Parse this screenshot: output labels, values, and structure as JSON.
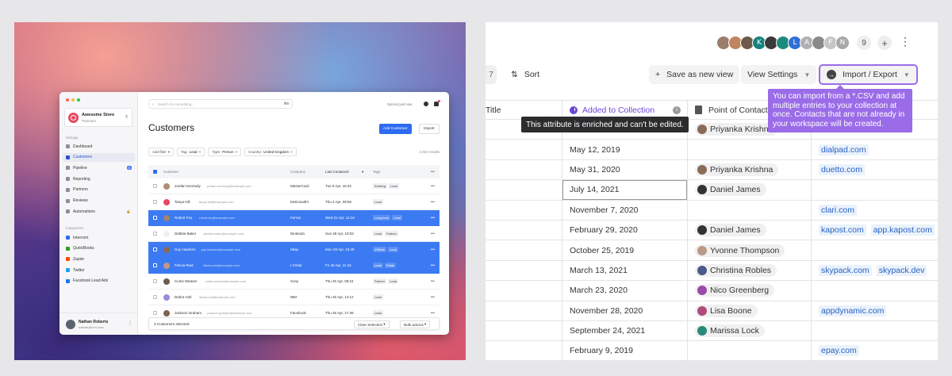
{
  "left": {
    "sidebar": {
      "store_name": "Awesome Store",
      "store_plan": "Premium",
      "manage_label": "Manage",
      "manage_items": [
        {
          "label": "Dashboard",
          "icon": "home-icon"
        },
        {
          "label": "Customers",
          "icon": "users-icon",
          "active": true
        },
        {
          "label": "Pipeline",
          "icon": "pipeline-icon",
          "badge": "6"
        },
        {
          "label": "Reporting",
          "icon": "chart-icon"
        },
        {
          "label": "Partners",
          "icon": "partners-icon"
        },
        {
          "label": "Reviews",
          "icon": "reviews-icon"
        },
        {
          "label": "Automations",
          "icon": "automations-icon",
          "locked": true
        }
      ],
      "integrations_label": "Integrations",
      "integration_items": [
        {
          "label": "Intercom",
          "color": "#2d6bf0"
        },
        {
          "label": "QuickBooks",
          "color": "#2ca01c"
        },
        {
          "label": "Zapier",
          "color": "#ff4a00"
        },
        {
          "label": "Twitter",
          "color": "#1da1f2"
        },
        {
          "label": "Facebook Lead Ads",
          "color": "#1877f2"
        }
      ],
      "user_name": "Nathan Roberts",
      "user_email": "nathan@crm.com"
    },
    "header": {
      "search_placeholder": "Search for something...",
      "search_shortcut": "⌘K",
      "synced": "Synced just now",
      "title": "Customers",
      "add_button": "Add Customer",
      "import_button": "Import"
    },
    "filters": {
      "add_filter": "Add filter",
      "chips": [
        {
          "key": "Tag:",
          "value": "Lead"
        },
        {
          "key": "Type:",
          "value": "Person"
        },
        {
          "key": "Country:",
          "value": "United Kingdom"
        }
      ],
      "results": "1,024 results"
    },
    "table": {
      "headers": {
        "customer": "Customer",
        "company": "Company",
        "last_contacted": "Last Contacted",
        "tags": "Tags"
      },
      "rows": [
        {
          "name": "Jordan Kennedy",
          "email": "jordan.kennedy@example.com",
          "company": "MasterCard",
          "date": "Tue 6 Apr, 16:42",
          "tags": [
            "Existing",
            "Lead"
          ],
          "selected": false,
          "avatar_color": "#b08c74"
        },
        {
          "name": "Tanya Hill",
          "email": "tanya.hill@example.com",
          "company": "McDonald's",
          "date": "Thu 2 Apr, 09:56",
          "tags": [
            "Lead"
          ],
          "selected": false,
          "avatar_color": "#e8485f"
        },
        {
          "name": "Robert Fox",
          "email": "robert.fox@example.com",
          "company": "Ferrari",
          "date": "Wed 31 Apr, 12:34",
          "tags": [
            "Long-term",
            "Lead"
          ],
          "selected": true,
          "avatar_color": "#a0826d"
        },
        {
          "name": "Debbie Baker",
          "email": "debbie.baker@example.com",
          "company": "Nintendo",
          "date": "Sun 28 Apr, 19:03",
          "tags": [
            "Lead",
            "Partner"
          ],
          "selected": false,
          "avatar_color": "#f0f0f0"
        },
        {
          "name": "Guy Hawkins",
          "email": "guy.hawkins@example.com",
          "company": "eBay",
          "date": "Mon 29 Apr, 15:49",
          "tags": [
            "Affiliate",
            "Lead"
          ],
          "selected": true,
          "avatar_color": "#8a6a55"
        },
        {
          "name": "Felicia Reid",
          "email": "felicia.reid@example.com",
          "company": "L'Oréal",
          "date": "Fri 26 Apr, 11:43",
          "tags": [
            "Lead",
            "Retail"
          ],
          "selected": true,
          "avatar_color": "#c49a82"
        },
        {
          "name": "Curtis Weaver",
          "email": "curtis.weaver@example.com",
          "company": "Sony",
          "date": "Thu 25 Apr, 08:24",
          "tags": [
            "Partner",
            "Lead"
          ],
          "selected": false,
          "avatar_color": "#6d5a4e"
        },
        {
          "name": "Debra Holt",
          "email": "debra.holt@example.com",
          "company": "IBM",
          "date": "Thu 25 Apr, 14:12",
          "tags": [
            "Lead"
          ],
          "selected": false,
          "avatar_color": "#9b8bd8"
        },
        {
          "name": "Jackson Graham",
          "email": "jackson.graham@example.com",
          "company": "Facebook",
          "date": "Thu 25 Apr, 17:39",
          "tags": [
            "Lead"
          ],
          "selected": false,
          "avatar_color": "#7d6250"
        }
      ]
    },
    "bulk": {
      "count": "3 Customers selected",
      "clear": "Clear Selection",
      "actions": "Bulk actions"
    }
  },
  "right": {
    "avatars": [
      {
        "color": "#9b7d6a",
        "letter": ""
      },
      {
        "color": "#c08560",
        "letter": ""
      },
      {
        "color": "#6e5a4c",
        "letter": ""
      },
      {
        "color": "#16817e",
        "letter": "K"
      },
      {
        "color": "#3b3b3b",
        "letter": ""
      },
      {
        "color": "#1e8a7e",
        "letter": ""
      },
      {
        "color": "#2e6fd6",
        "letter": "L"
      },
      {
        "color": "#b0b0b0",
        "letter": "A"
      },
      {
        "color": "#8a8a8a",
        "letter": ""
      },
      {
        "color": "#c5c5c5",
        "letter": "F"
      },
      {
        "color": "#a8a8a8",
        "letter": "N"
      }
    ],
    "member_count": "9",
    "toolbar": {
      "prev_label": "7",
      "sort": "Sort",
      "save_view": "Save as new view",
      "view_settings": "View Settings",
      "import_export": "Import / Export"
    },
    "tooltips": {
      "attribute": "This attribute is enriched and can't be edited.",
      "import": "You can import from a *.CSV and add multiple entries to your collection at once. Contacts that are not already in your workspace will be created."
    },
    "grid": {
      "headers": {
        "title": "Title",
        "added": "Added to Collection",
        "poc": "Point of Contact"
      },
      "rows": [
        {
          "date": "",
          "poc": "Priyanka Krishna",
          "poc_color": "#8a6b57",
          "domains": []
        },
        {
          "date": "May 12, 2019",
          "poc": "",
          "domains": [
            "dialpad.com"
          ]
        },
        {
          "date": "May 31, 2020",
          "poc": "Priyanka Krishna",
          "poc_color": "#8a6b57",
          "domains": [
            "duetto.com"
          ]
        },
        {
          "date": "July 14, 2021",
          "poc": "Daniel James",
          "poc_color": "#333333",
          "domains": [],
          "focused": true
        },
        {
          "date": "November 7, 2020",
          "poc": "",
          "domains": [
            "clari.com"
          ]
        },
        {
          "date": "February 29, 2020",
          "poc": "Daniel James",
          "poc_color": "#333333",
          "domains": [
            "kapost.com",
            "app.kapost.com"
          ]
        },
        {
          "date": "October 25, 2019",
          "poc": "Yvonne Thompson",
          "poc_color": "#b89a86",
          "domains": []
        },
        {
          "date": "March 13, 2021",
          "poc": "Christina Robles",
          "poc_color": "#4a5a8a",
          "domains": [
            "skypack.com",
            "skypack.dev"
          ]
        },
        {
          "date": "March 23, 2020",
          "poc": "Nico Greenberg",
          "poc_color": "#9a4aa8",
          "domains": []
        },
        {
          "date": "November 28, 2020",
          "poc": "Lisa Boone",
          "poc_color": "#b04a7a",
          "domains": [
            "appdynamic.com"
          ]
        },
        {
          "date": "September 24, 2021",
          "poc": "Marissa Lock",
          "poc_color": "#2a8a7a",
          "domains": []
        },
        {
          "date": "February 9, 2019",
          "poc": "",
          "domains": [
            "epay.com"
          ]
        }
      ]
    }
  }
}
